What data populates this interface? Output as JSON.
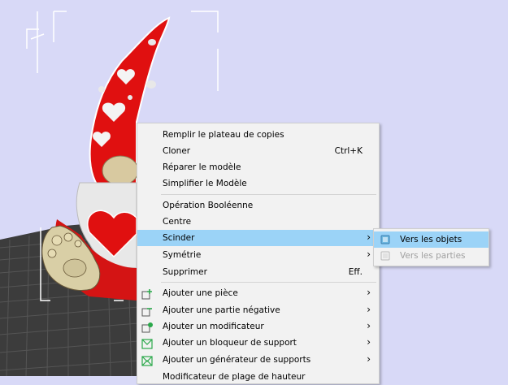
{
  "context_menu": {
    "items": [
      {
        "label": "Remplir le plateau de copies",
        "shortcut": "",
        "submenu": false
      },
      {
        "label": "Cloner",
        "shortcut": "Ctrl+K",
        "submenu": false
      },
      {
        "label": "Réparer le modèle",
        "shortcut": "",
        "submenu": false
      },
      {
        "label": "Simplifier le Modèle",
        "shortcut": "",
        "submenu": false
      },
      {
        "label": "Opération Booléenne",
        "shortcut": "",
        "submenu": false
      },
      {
        "label": "Centre",
        "shortcut": "",
        "submenu": false
      },
      {
        "label": "Scinder",
        "shortcut": "",
        "submenu": true,
        "highlighted": true
      },
      {
        "label": "Symétrie",
        "shortcut": "",
        "submenu": true
      },
      {
        "label": "Supprimer",
        "shortcut": "Eff.",
        "submenu": false
      },
      {
        "label": "Ajouter une pièce",
        "shortcut": "",
        "submenu": true,
        "icon": "add-part-icon"
      },
      {
        "label": "Ajouter une partie négative",
        "shortcut": "",
        "submenu": true,
        "icon": "add-negative-part-icon"
      },
      {
        "label": "Ajouter un modificateur",
        "shortcut": "",
        "submenu": true,
        "icon": "add-modifier-icon"
      },
      {
        "label": "Ajouter un bloqueur de support",
        "shortcut": "",
        "submenu": true,
        "icon": "support-blocker-icon"
      },
      {
        "label": "Ajouter un générateur de supports",
        "shortcut": "",
        "submenu": true,
        "icon": "support-enforcer-icon"
      },
      {
        "label": "Modificateur de plage de hauteur",
        "shortcut": "",
        "submenu": false
      }
    ]
  },
  "split_submenu": {
    "items": [
      {
        "label": "Vers les objets",
        "highlighted": true,
        "icon": "split-objects-icon"
      },
      {
        "label": "Vers les parties",
        "disabled": true,
        "icon": "split-parts-icon"
      }
    ]
  },
  "colors": {
    "background": "#d8d9f7",
    "menu_bg": "#f2f2f2",
    "highlight": "#9bd3f7",
    "bed": "#3a3a3a",
    "model_red": "#e01010"
  }
}
